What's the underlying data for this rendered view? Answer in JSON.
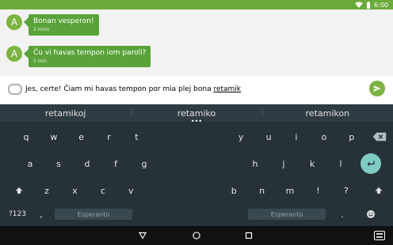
{
  "status_bar": {
    "time": "6:00"
  },
  "chat": {
    "messages": [
      {
        "avatar": "A",
        "text": "Bonan vesperon!",
        "time": "2 mins"
      },
      {
        "avatar": "A",
        "text": "Ĉu vi havas tempon iom paroli?",
        "time": "1 min"
      }
    ]
  },
  "composer": {
    "text_prefix": "Jes, certe! Ĉiam mi havas tempon por mia plej bona ",
    "text_underlined": "retamik"
  },
  "keyboard": {
    "suggestions": [
      "retamikoj",
      "retamiko",
      "retamikon"
    ],
    "rows": {
      "row1_left": [
        {
          "label": "q",
          "sub": ""
        },
        {
          "label": "w",
          "sub": ""
        },
        {
          "label": "e",
          "sub": ""
        },
        {
          "label": "r",
          "sub": ""
        },
        {
          "label": "t",
          "sub": ""
        }
      ],
      "row1_right": [
        {
          "label": "y",
          "sub": ""
        },
        {
          "label": "u",
          "sub": ""
        },
        {
          "label": "i",
          "sub": ""
        },
        {
          "label": "o",
          "sub": ""
        },
        {
          "label": "p",
          "sub": ""
        }
      ],
      "row2_left": [
        {
          "label": "a",
          "sub": ""
        },
        {
          "label": "s",
          "sub": ""
        },
        {
          "label": "d",
          "sub": ""
        },
        {
          "label": "f",
          "sub": ""
        },
        {
          "label": "g",
          "sub": ""
        }
      ],
      "row2_right": [
        {
          "label": "h",
          "sub": ""
        },
        {
          "label": "j",
          "sub": ""
        },
        {
          "label": "k",
          "sub": ""
        },
        {
          "label": "l",
          "sub": ""
        }
      ],
      "row3_left": [
        {
          "label": "z",
          "sub": ""
        },
        {
          "label": "x",
          "sub": ""
        },
        {
          "label": "c",
          "sub": ""
        },
        {
          "label": "v",
          "sub": ""
        }
      ],
      "row3_right": [
        {
          "label": "b",
          "sub": ""
        },
        {
          "label": "n",
          "sub": ""
        },
        {
          "label": "m",
          "sub": ""
        },
        {
          "label": "!",
          "sub": ""
        },
        {
          "label": "?",
          "sub": ""
        }
      ]
    },
    "bottom_row": {
      "symbols_label": "?123",
      "comma_label": ",",
      "left_space_label": "Esperanto",
      "right_space_label": "Esperanto",
      "period_label": "."
    }
  },
  "icons": {
    "wifi": "wifi-icon",
    "battery": "battery-icon",
    "send": "send-icon",
    "attach": "attach-icon",
    "backspace": "backspace-icon",
    "enter": "enter-icon",
    "shift": "shift-icon",
    "emoji": "emoji-icon",
    "back": "back-icon",
    "home": "home-icon",
    "recents": "recents-icon",
    "keyboard": "keyboard-icon"
  }
}
